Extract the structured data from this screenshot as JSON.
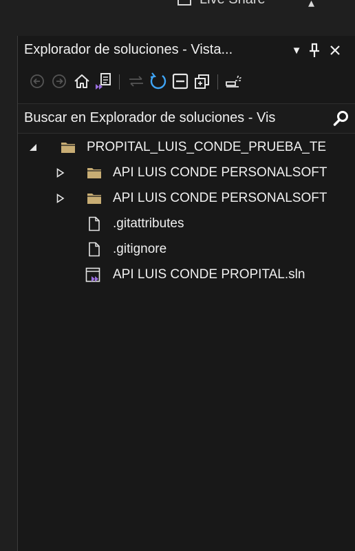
{
  "top_strip": {
    "partial_text": "Live Share"
  },
  "panel": {
    "title": "Explorador de soluciones - Vista...",
    "buttons": [
      {
        "name": "dropdown",
        "glyph": "▼"
      },
      {
        "name": "pin",
        "glyph": "🖈"
      },
      {
        "name": "close",
        "glyph": "✕"
      }
    ]
  },
  "toolbar": {
    "tools": [
      "back-icon",
      "forward-icon",
      "home-icon",
      "switch-views-icon",
      "sync-icon",
      "refresh-icon",
      "collapse-all-icon",
      "show-all-files-icon",
      "properties-icon"
    ]
  },
  "search": {
    "placeholder": "Buscar en Explorador de soluciones - Vis"
  },
  "tree": {
    "items": [
      {
        "label": "PROPITAL_LUIS_CONDE_PRUEBA_TE",
        "type": "folder",
        "expanded": true,
        "level": 0
      },
      {
        "label": "API LUIS CONDE PERSONALSOFT",
        "type": "folder",
        "expanded": false,
        "level": 1
      },
      {
        "label": "API LUIS CONDE PERSONALSOFT",
        "type": "folder",
        "expanded": false,
        "level": 1
      },
      {
        "label": ".gitattributes",
        "type": "file",
        "level": 1
      },
      {
        "label": ".gitignore",
        "type": "file",
        "level": 1
      },
      {
        "label": "API LUIS CONDE PROPITAL.sln",
        "type": "solution",
        "level": 1
      }
    ]
  },
  "colors": {
    "folder": "#c8ad74",
    "accent_blue": "#3fa5f6",
    "vs_purple": "#9b6fe0",
    "icon_gray": "#e6e6e6",
    "disabled": "#555555"
  }
}
